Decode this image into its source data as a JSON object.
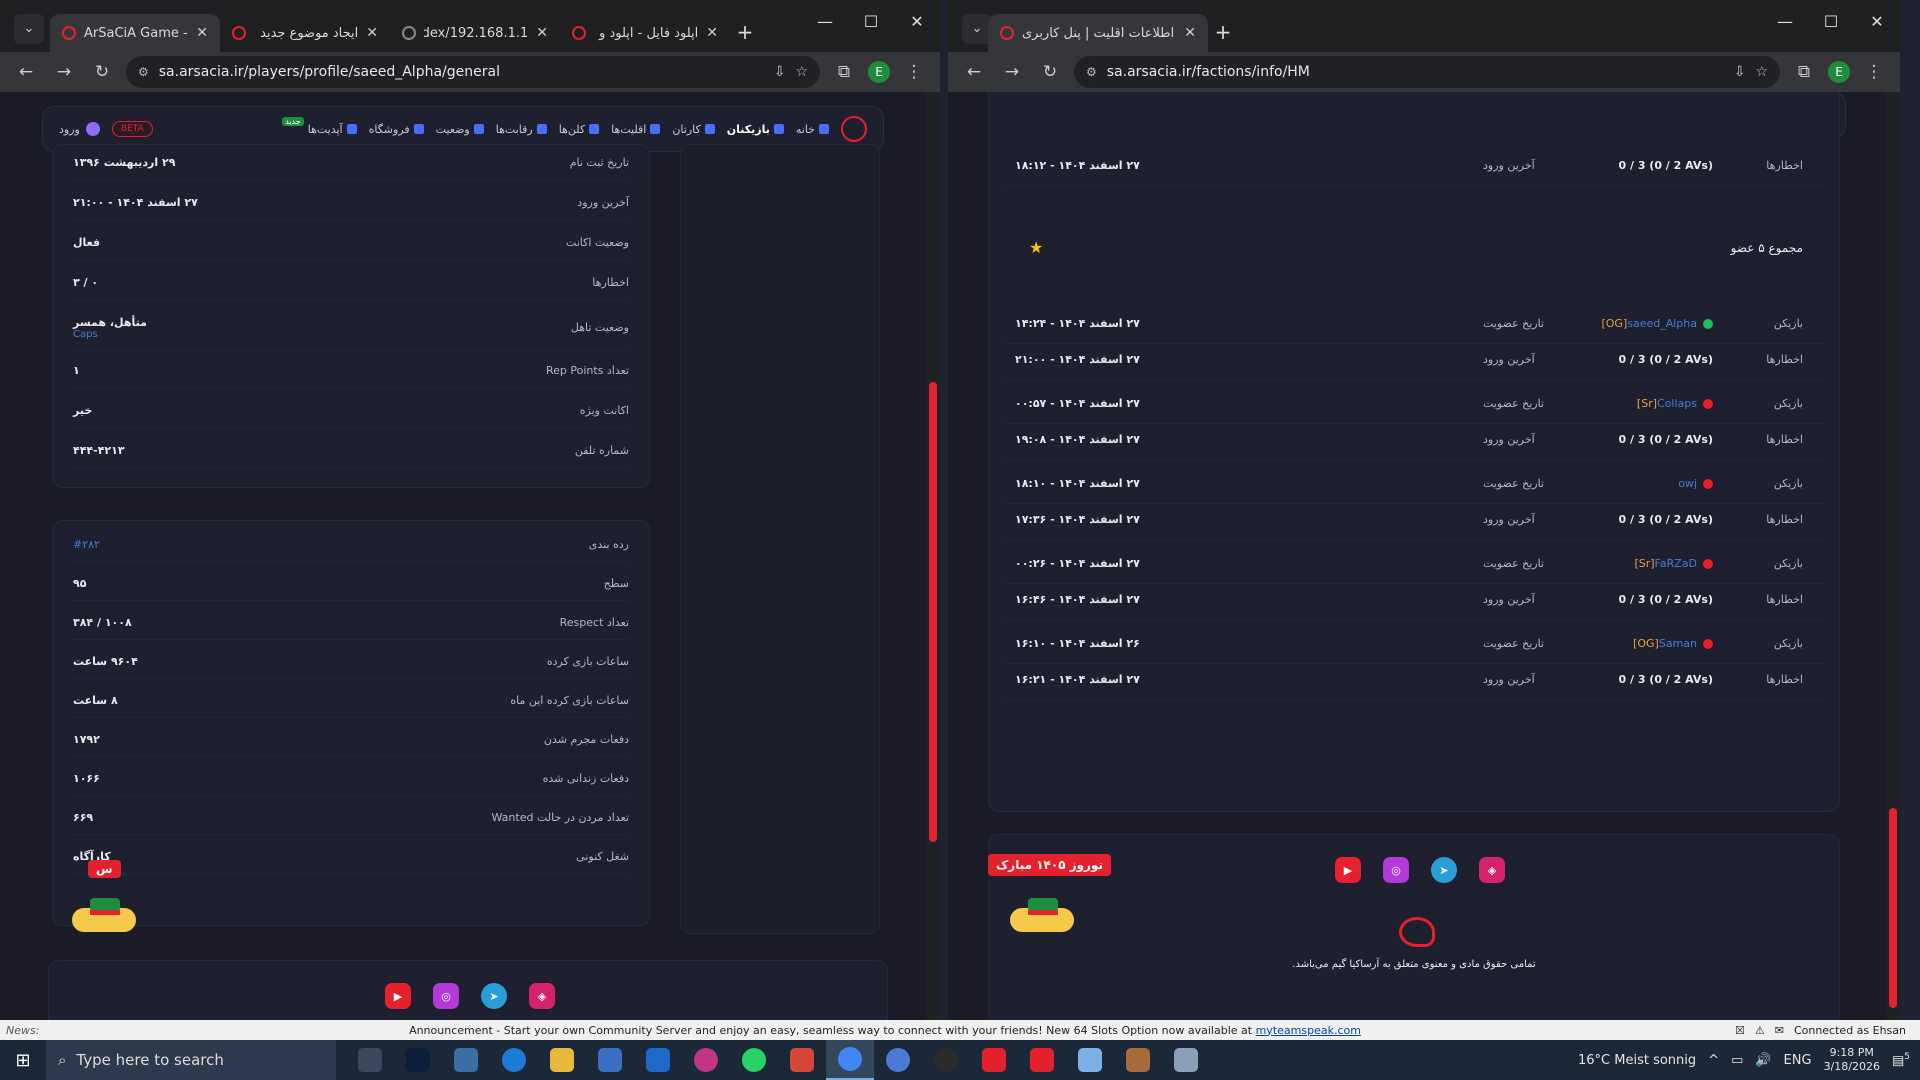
{
  "left_window": {
    "tabs": [
      {
        "title": "ArSaCiA Game - N",
        "active": true
      },
      {
        "title": "ایجاد موضوع جدید"
      },
      {
        "title": "192.168.1.1/index."
      },
      {
        "title": "آپلود فایل - اپلود و"
      }
    ],
    "url": "sa.arsacia.ir/players/profile/saeed_Alpha/general",
    "profile_rows": [
      {
        "label": "تاریخ ثبت نام",
        "value": "۲۹ اردیبهشت ۱۳۹۶"
      },
      {
        "label": "آخرین ورود",
        "value": "۲۷ اسفند ۱۴۰۴ - ۲۱:۰۰"
      },
      {
        "label": "وضعیت اکانت",
        "value": "فعال"
      },
      {
        "label": "اخطارها",
        "value": "۰ / ۳"
      },
      {
        "label": "وضعیت تاهل",
        "value": "متأهل، همسر",
        "sub": "Caps"
      },
      {
        "label": "تعداد Rep Points",
        "value": "۱"
      },
      {
        "label": "اکانت ویژه",
        "value": "خیر"
      },
      {
        "label": "شماره تلفن",
        "value": "۴۴۴-۴۲۱۳"
      }
    ],
    "stats_rows": [
      {
        "label": "رده بندی",
        "value": "#۲۸۲",
        "blue": true
      },
      {
        "label": "سطح",
        "value": "۹۵"
      },
      {
        "label": "تعداد Respect",
        "value": "۱۰۰۸ / ۳۸۴"
      },
      {
        "label": "ساعات بازی کرده",
        "value": "۹۶۰۴ ساعت"
      },
      {
        "label": "ساعات بازی کرده این ماه",
        "value": "۸ ساعت"
      },
      {
        "label": "دفعات مجرم شدن",
        "value": "۱۷۹۲"
      },
      {
        "label": "دفعات زندانی شده",
        "value": "۱۰۶۶"
      },
      {
        "label": "تعداد مردن در حالت Wanted",
        "value": "۶۶۹"
      },
      {
        "label": "شغل کنونی",
        "value": "کارآگاه"
      }
    ],
    "floating_badge": "س"
  },
  "right_window": {
    "tabs": [
      {
        "title": "اطلاعات اقلیت | پنل کاربری",
        "active": true
      }
    ],
    "url": "sa.arsacia.ir/factions/info/HM",
    "top_row": {
      "label": "اخطارها",
      "value": "0 / 3 (0 / 2 AVs)",
      "last_login_label": "آخرین ورود",
      "last_login": "۲۷ اسفند ۱۴۰۴ - ۱۸:۱۲"
    },
    "members_total": "مجموع ۵ عضو",
    "members": [
      {
        "tag": "[OG]",
        "name": "saeed_Alpha",
        "status": "online",
        "join_label": "تاریخ عضویت",
        "join": "۲۷ اسفند ۱۴۰۴ - ۱۴:۲۴",
        "warns": "0 / 3 (0 / 2 AVs)",
        "last_label": "آخرین ورود",
        "last": "۲۷ اسفند ۱۴۰۴ - ۲۱:۰۰"
      },
      {
        "tag": "[Sr]",
        "name": "Collaps",
        "status": "offline",
        "join_label": "تاریخ عضویت",
        "join": "۲۷ اسفند ۱۴۰۴ - ۰۰:۵۷",
        "warns": "0 / 3 (0 / 2 AVs)",
        "last_label": "آخرین ورود",
        "last": "۲۷ اسفند ۱۴۰۴ - ۱۹:۰۸"
      },
      {
        "tag": "",
        "name": "owj",
        "status": "offline",
        "join_label": "تاریخ عضویت",
        "join": "۲۷ اسفند ۱۴۰۴ - ۱۸:۱۰",
        "warns": "0 / 3 (0 / 2 AVs)",
        "last_label": "آخرین ورود",
        "last": "۲۷ اسفند ۱۴۰۴ - ۱۷:۳۶"
      },
      {
        "tag": "[Sr]",
        "name": "FaRZaD",
        "status": "offline",
        "join_label": "تاریخ عضویت",
        "join": "۲۷ اسفند ۱۴۰۴ - ۰۰:۲۶",
        "warns": "0 / 3 (0 / 2 AVs)",
        "last_label": "آخرین ورود",
        "last": "۲۷ اسفند ۱۴۰۴ - ۱۶:۴۶"
      },
      {
        "tag": "[OG]",
        "name": "Saman",
        "status": "offline",
        "join_label": "تاریخ عضویت",
        "join": "۲۶ اسفند ۱۴۰۴ - ۱۶:۱۰",
        "warns": "0 / 3 (0 / 2 AVs)",
        "last_label": "آخرین ورود",
        "last": "۲۷ اسفند ۱۴۰۴ - ۱۶:۲۱"
      }
    ],
    "player_label": "بازیکن",
    "warns_label": "اخطارها",
    "nowruz": "نوروز ۱۴۰۵ مبارک",
    "copyright": "تمامی حقوق مادی و معنوی متعلق به آرساکیا گیم می‌باشد."
  },
  "site_nav": {
    "items": [
      "خانه",
      "بازیکنان",
      "کارتان",
      "اقلیت‌ها",
      "کلن‌ها",
      "رقابت‌ها",
      "وضعیت",
      "فروشگاه",
      "آپدیت‌ها"
    ],
    "new_badge": "جدید",
    "beta": "BETA",
    "login": "ورود"
  },
  "ticker": {
    "news_label": "News:",
    "message": "Announcement - Start your own Community Server and enjoy an easy, seamless way to connect with your friends! New 64 Slots Option now available at ",
    "link": "myteamspeak.com",
    "connection": "Connected as Ehsan"
  },
  "taskbar": {
    "search_placeholder": "Type here to search",
    "weather": "16°C  Meist sonnig",
    "lang": "ENG",
    "time": "9:18 PM",
    "date": "3/18/2026",
    "notif_count": "5",
    "apps": [
      "task-view",
      "photoshop",
      "qbittorrent",
      "edge",
      "file-explorer",
      "store",
      "outlook",
      "instagram",
      "whatsapp",
      "pdf",
      "chrome",
      "browser-blue",
      "steam",
      "youtube",
      "arsacia",
      "notepad",
      "game",
      "remote"
    ]
  },
  "colors": {
    "accent": "#e5212e",
    "link": "#4a7bd4",
    "tag": "#e6a23c",
    "online": "#1fbf55",
    "offline": "#e5212e",
    "bg": "#1a1b27",
    "card": "#1e2030"
  }
}
